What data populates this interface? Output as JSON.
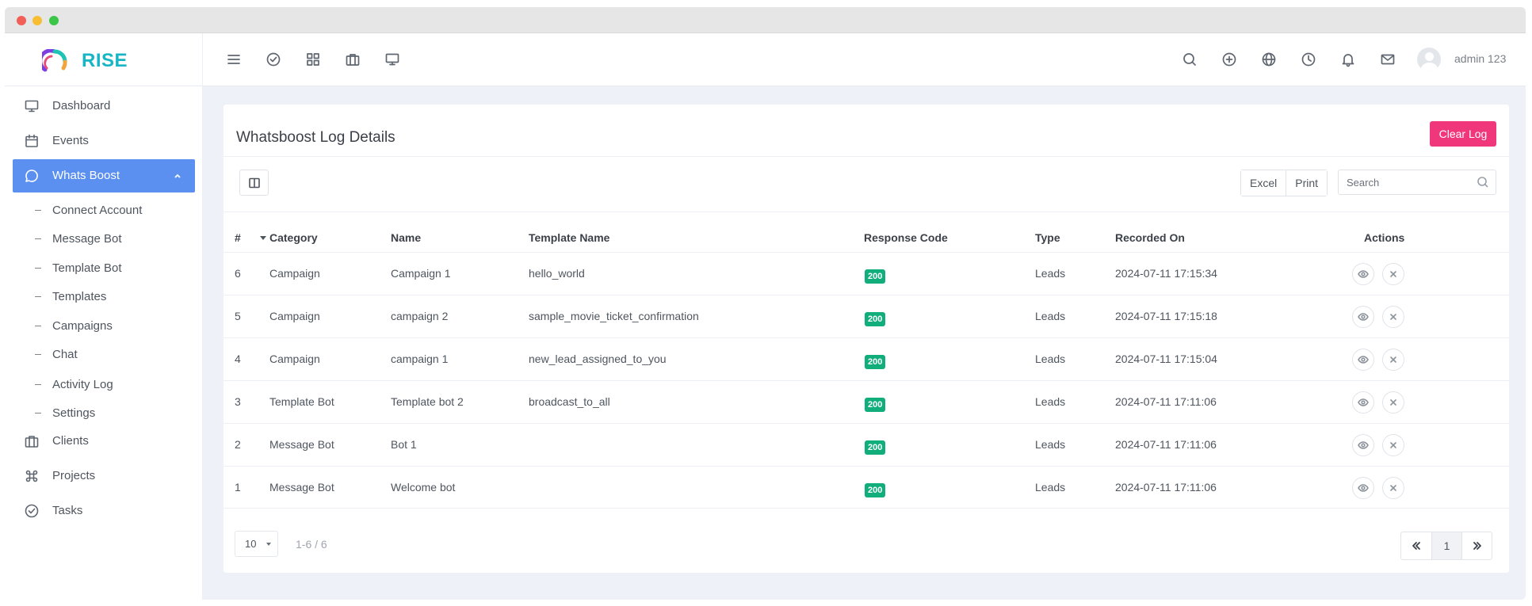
{
  "app": {
    "brand": "RISE"
  },
  "header": {
    "user_name": "admin 123"
  },
  "sidebar": {
    "items": [
      {
        "label": "Dashboard"
      },
      {
        "label": "Events"
      },
      {
        "label": "Whats Boost"
      }
    ],
    "sub_items": [
      {
        "label": "Connect Account"
      },
      {
        "label": "Message Bot"
      },
      {
        "label": "Template Bot"
      },
      {
        "label": "Templates"
      },
      {
        "label": "Campaigns"
      },
      {
        "label": "Chat"
      },
      {
        "label": "Activity Log"
      },
      {
        "label": "Settings"
      }
    ],
    "bottom_items": [
      {
        "label": "Clients"
      },
      {
        "label": "Projects"
      },
      {
        "label": "Tasks"
      }
    ]
  },
  "card": {
    "title": "Whatsboost Log Details",
    "clear_label": "Clear Log",
    "excel_label": "Excel",
    "print_label": "Print",
    "search_placeholder": "Search"
  },
  "table": {
    "headers": [
      "#",
      "Category",
      "Name",
      "Template Name",
      "Response Code",
      "Type",
      "Recorded On",
      "Actions"
    ],
    "rows": [
      {
        "id": "6",
        "category": "Campaign",
        "name": "Campaign 1",
        "template": "hello_world",
        "code": "200",
        "type": "Leads",
        "recorded": "2024-07-11 17:15:34"
      },
      {
        "id": "5",
        "category": "Campaign",
        "name": "campaign 2",
        "template": "sample_movie_ticket_confirmation",
        "code": "200",
        "type": "Leads",
        "recorded": "2024-07-11 17:15:18"
      },
      {
        "id": "4",
        "category": "Campaign",
        "name": "campaign 1",
        "template": "new_lead_assigned_to_you",
        "code": "200",
        "type": "Leads",
        "recorded": "2024-07-11 17:15:04"
      },
      {
        "id": "3",
        "category": "Template Bot",
        "name": "Template bot 2",
        "template": "broadcast_to_all",
        "code": "200",
        "type": "Leads",
        "recorded": "2024-07-11 17:11:06"
      },
      {
        "id": "2",
        "category": "Message Bot",
        "name": "Bot 1",
        "template": "",
        "code": "200",
        "type": "Leads",
        "recorded": "2024-07-11 17:11:06"
      },
      {
        "id": "1",
        "category": "Message Bot",
        "name": "Welcome bot",
        "template": "",
        "code": "200",
        "type": "Leads",
        "recorded": "2024-07-11 17:11:06"
      }
    ]
  },
  "footer": {
    "page_size": "10",
    "range": "1-6 / 6",
    "current_page": "1"
  },
  "colors": {
    "accent": "#5b8ff0",
    "danger": "#f1377b",
    "success": "#11ad7b",
    "brand": "#18b6c4"
  }
}
